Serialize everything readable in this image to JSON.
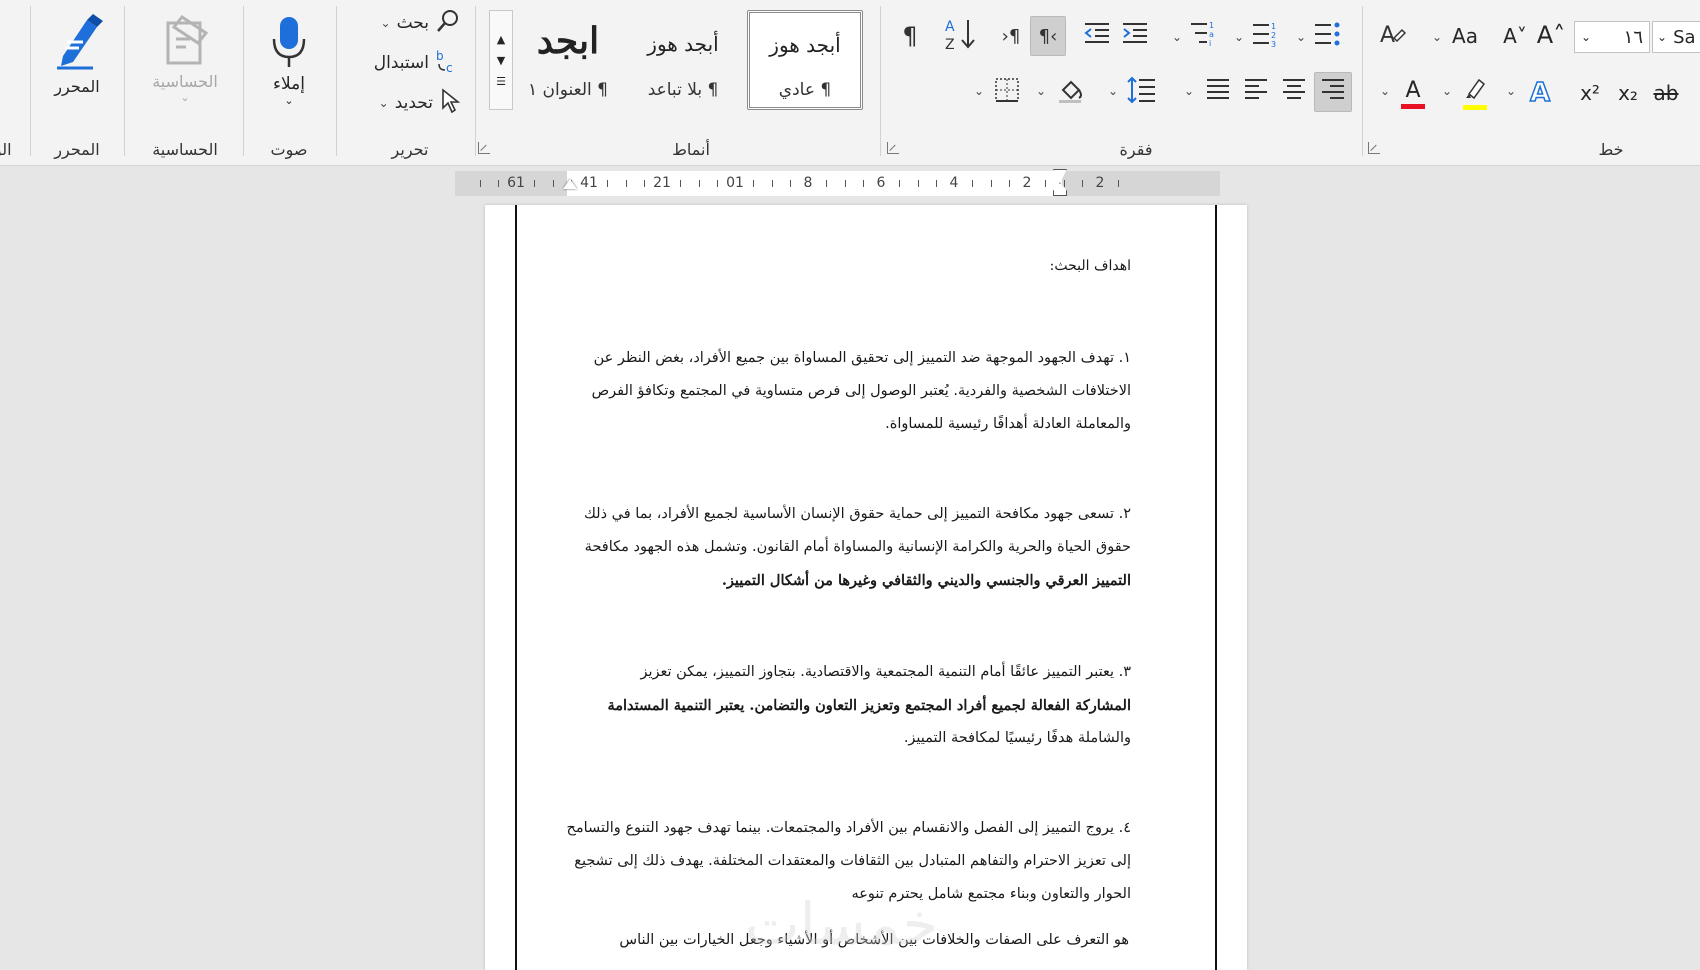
{
  "ribbon": {
    "editor": {
      "button": "المحرر",
      "group": "المحرر"
    },
    "sensitivity": {
      "button": "الحساسية",
      "group": "الحساسية"
    },
    "voice": {
      "button": "إملاء",
      "group": "صوت"
    },
    "editing": {
      "find": "بحث",
      "replace": "استبدال",
      "select": "تحديد",
      "group": "تحرير"
    },
    "styles": {
      "group": "أنماط",
      "items": [
        {
          "sample": "أبجد هوز",
          "name": "¶ عادي",
          "selected": true
        },
        {
          "sample": "أبجد هوز",
          "name": "¶ بلا تباعد",
          "selected": false
        },
        {
          "sample": "ابجد",
          "name": "¶ العنوان ١",
          "selected": false
        }
      ]
    },
    "paragraph": {
      "group": "فقرة"
    },
    "font": {
      "group": "خط",
      "size": "١٦",
      "name": "Sa",
      "colors": {
        "font_color": "#e81123",
        "highlight": "#ffff00",
        "text_effect": "#1e6fd9"
      }
    },
    "partial_tab": "الو"
  },
  "ruler": {
    "labels": [
      "61",
      "41",
      "21",
      "01",
      "8",
      "6",
      "4",
      "2",
      "2"
    ]
  },
  "document": {
    "heading": "اهداف البحث:",
    "paragraphs": [
      [
        "١. تهدف الجهود الموجهة ضد التمييز إلى تحقيق المساواة بين جميع الأفراد، بغض النظر عن",
        "الاختلافات الشخصية والفردية. يُعتبر الوصول إلى فرص متساوية في المجتمع وتكافؤ الفرص",
        "والمعاملة العادلة أهدافًا رئيسية للمساواة."
      ],
      [
        "٢. تسعى جهود مكافحة التمييز إلى حماية حقوق الإنسان الأساسية لجميع الأفراد، بما في ذلك",
        "حقوق الحياة والحرية والكرامة الإنسانية والمساواة أمام القانون. وتشمل هذه الجهود مكافحة",
        "التمييز العرقي والجنسي والديني والثقافي وغيرها من أشكال التمييز."
      ],
      [
        "٣. يعتبر التمييز عائقًا أمام التنمية المجتمعية والاقتصادية. بتجاوز التمييز، يمكن تعزيز",
        "المشاركة الفعالة لجميع أفراد المجتمع وتعزيز التعاون والتضامن. يعتبر التنمية المستدامة",
        "والشاملة هدفًا رئيسيًا لمكافحة التمييز."
      ],
      [
        "٤. يروج التمييز إلى الفصل والانقسام بين الأفراد والمجتمعات. بينما تهدف جهود التنوع والتسامح",
        "إلى تعزيز الاحترام والتفاهم المتبادل بين الثقافات والمعتقدات المختلفة. يهدف ذلك إلى تشجيع",
        "الحوار والتعاون وبناء مجتمع شامل يحترم تنوعه"
      ]
    ],
    "last_line": "هو التعرف على الصفات والخلافات بين الأشخاص أو الأشياء وجعل الخيارات بين الناس",
    "watermark": "خمسات"
  }
}
